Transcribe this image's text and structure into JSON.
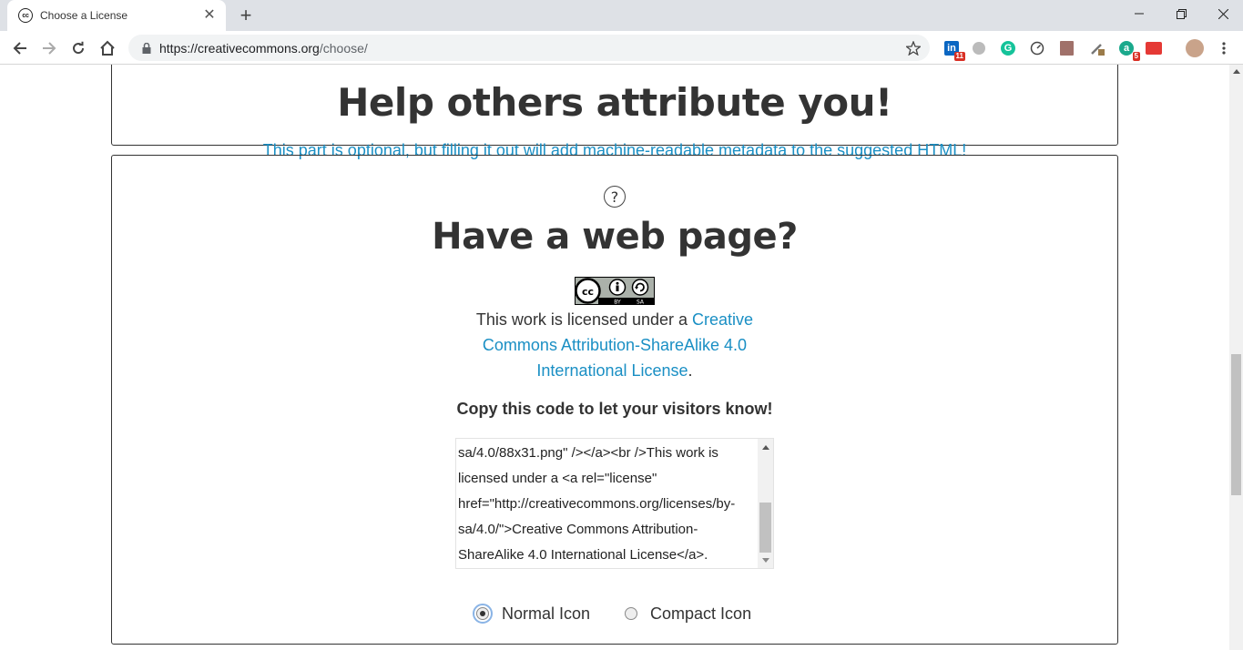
{
  "browser": {
    "tab_title": "Choose a License",
    "tab_favicon": "cc",
    "url_host": "https://creativecommons.org",
    "url_path": "/choose/",
    "extension_badges": {
      "linkedin": "11",
      "ext_a": "5"
    },
    "icons": {
      "back": "back-arrow-icon",
      "forward": "forward-arrow-icon",
      "reload": "reload-icon",
      "home": "home-icon",
      "lock": "lock-icon",
      "bookmark": "star-icon",
      "menu": "kebab-menu-icon"
    }
  },
  "page": {
    "attr_heading": "Help others attribute you!",
    "attr_subtext": "This part is optional, but filling it out will add machine-readable metadata to the suggested HTML!",
    "web_heading": "Have a web page?",
    "help_icon_glyph": "?",
    "license_badge": {
      "main": "cc",
      "by": "BY",
      "sa": "SA"
    },
    "license_text_prefix": "This work is licensed under a ",
    "license_link": "Creative Commons Attribution-ShareAlike 4.0 International License",
    "license_text_suffix": ".",
    "copy_heading": "Copy this code to let your visitors know!",
    "code_lines": [
      "sa/4.0/88x31.png\" /></a><br />This work is",
      "licensed under a <a rel=\"license\"",
      "href=\"http://creativecommons.org/licenses/by-",
      "sa/4.0/\">Creative Commons Attribution-",
      "ShareAlike 4.0 International License</a>."
    ],
    "radio_options": [
      {
        "label": "Normal Icon",
        "checked": true
      },
      {
        "label": "Compact Icon",
        "checked": false
      }
    ]
  },
  "colors": {
    "link": "#1a8fc4",
    "heading": "#333333"
  }
}
